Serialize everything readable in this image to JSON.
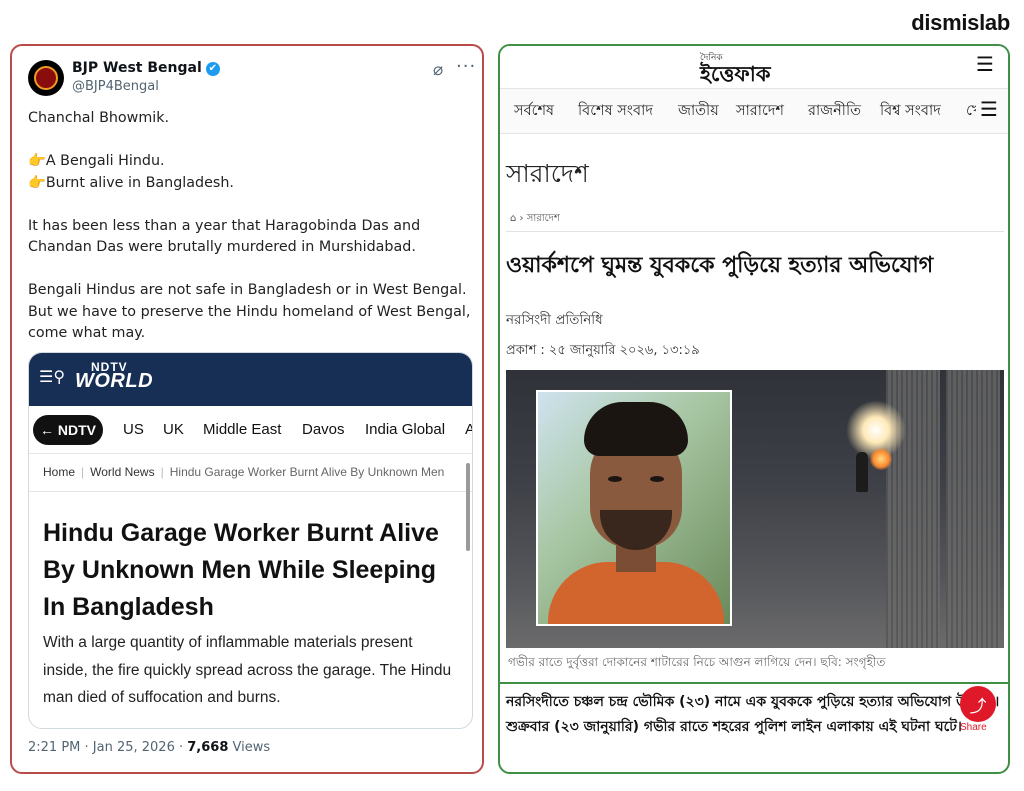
{
  "brand": "dismislab",
  "tweet": {
    "account_name": "BJP West Bengal",
    "handle": "@BJP4Bengal",
    "verified_mark": "✔",
    "paragraphs": [
      "Chanchal Bhowmik.",
      "A Bengali Hindu.",
      "Burnt alive in Bangladesh.",
      "It has been less than a year that Haragobinda Das and Chandan Das were brutally murdered in Murshidabad.",
      "Bengali Hindus are not safe in Bangladesh or in West Bengal. But we have to preserve the Hindu homeland of West Bengal, come what may."
    ],
    "pointer_emoji": "👉",
    "timestamp": "2:21 PM · Jan 25, 2026 · ",
    "views_count": "7,668",
    "views_label": " Views",
    "icons": {
      "grok": "grok-icon",
      "more": "more-options-icon"
    }
  },
  "ndtv": {
    "logo_top": "NDTV",
    "logo": "WORLD",
    "back_label": "← NDTV",
    "nav": [
      "US",
      "UK",
      "Middle East",
      "Davos",
      "India Global",
      "As"
    ],
    "breadcrumb": [
      "Home",
      "World News",
      "Hindu Garage Worker Burnt Alive By Unknown Men"
    ],
    "headline": "Hindu Garage Worker Burnt Alive By Unknown Men While Sleeping In Bangladesh",
    "summary": "With a large quantity of inflammable materials present inside, the fire quickly spread across the garage. The Hindu man died of suffocation and burns."
  },
  "ittefaq": {
    "logo_prefix": "দৈনিক",
    "logo": "ইত্তেফাক",
    "nav": [
      "সর্বশেষ",
      "বিশেষ সংবাদ",
      "জাতীয়",
      "সারাদেশ",
      "রাজনীতি",
      "বিশ্ব সংবাদ",
      "খেলা"
    ],
    "section": "সারাদেশ",
    "breadcrumb": "সারাদেশ",
    "headline": "ওয়ার্কশপে ঘুমন্ত যুবককে পুড়িয়ে হত্যার অভিযোগ",
    "reporter": "নরসিংদী প্রতিনিধি",
    "published": "প্রকাশ : ২৫ জানুয়ারি ২০২৬, ১৩:১৯",
    "caption": "গভীর রাতে দুর্বৃত্তরা দোকানের শাটারের নিচে আগুন লাগিয়ে দেন। ছবি: সংগৃহীত",
    "body": "নরসিংদীতে চঞ্চল চন্দ্র ভৌমিক (২৩) নামে এক যুবককে পুড়িয়ে হত্যার অভিযোগ উঠেছে। শুক্রবার (২৩ জানুয়ারি) গভীর রাতে শহরের পুলিশ লাইন এলাকায় এই ঘটনা ঘটে।",
    "share_label": "Share"
  },
  "colors": {
    "left_border": "#b94b4b",
    "right_border": "#3f8f47",
    "ndtv_blue": "#172f55",
    "verified_blue": "#1d9bf0",
    "share_red": "#e0192a"
  }
}
